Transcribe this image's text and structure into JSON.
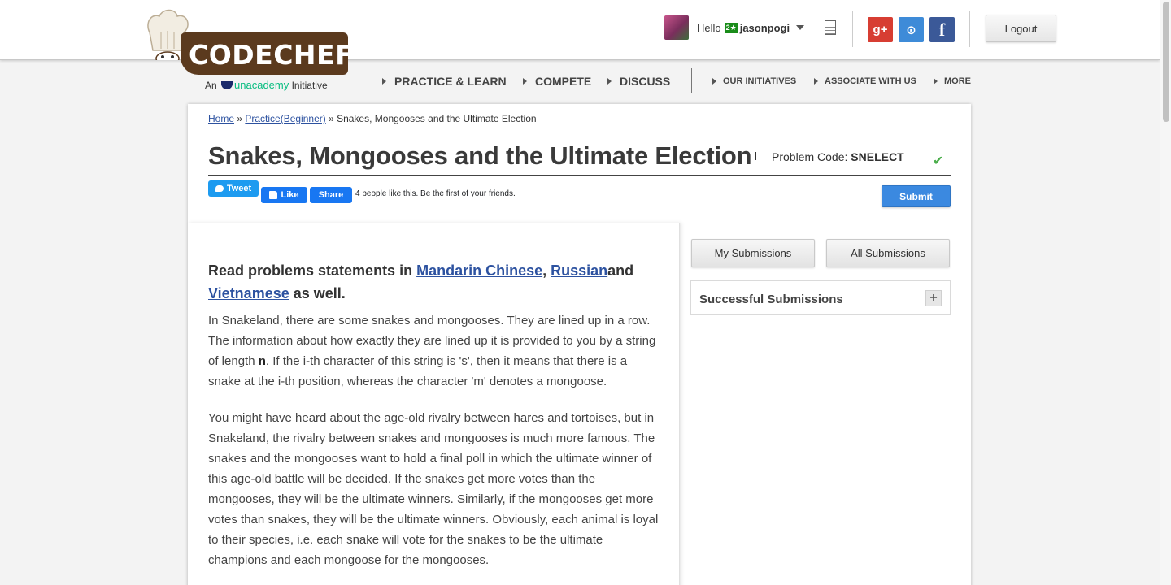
{
  "header": {
    "logo": {
      "brand": "CODECHEF",
      "sub_prefix": "An",
      "sub_brand": "unacademy",
      "sub_suffix": "Initiative"
    },
    "user": {
      "greeting": "Hello",
      "star_badge": "2★",
      "username": "jasonpogi"
    },
    "social": {
      "gplus": "g+",
      "github": "⊙",
      "facebook": "f"
    },
    "logout_label": "Logout"
  },
  "nav": {
    "main": [
      "PRACTICE & LEARN",
      "COMPETE",
      "DISCUSS"
    ],
    "secondary": [
      "OUR INITIATIVES",
      "ASSOCIATE WITH US",
      "MORE"
    ]
  },
  "breadcrumb": {
    "home": "Home",
    "sep1": " » ",
    "practice": "Practice(Beginner)",
    "sep2": " » ",
    "current": "Snakes, Mongooses and the Ultimate Election"
  },
  "problem": {
    "title": "Snakes, Mongooses and the Ultimate Election",
    "code_label": "Problem Code: ",
    "code": "SNELECT"
  },
  "share": {
    "tweet": "Tweet",
    "like": "Like",
    "share": "Share",
    "like_count_text": "4 people like this. Be the first of your friends.",
    "submit": "Submit"
  },
  "statement": {
    "read_prefix": "Read problems statements in ",
    "lang1": "Mandarin Chinese",
    "comma": ", ",
    "lang2": "Russian",
    "and": "and",
    "lang3": "Vietnamese",
    "read_suffix": " as well.",
    "p1_a": "In Snakeland, there are some snakes and mongooses. They are lined up in a row. The information about how exactly they are lined up it is provided to you by a string of length ",
    "p1_n": "n",
    "p1_b": ". If the i-th character of this string is 's', then it means that there is a snake at the i-th position, whereas the character 'm' denotes a mongoose.",
    "p2": "You might have heard about the age-old rivalry between hares and tortoises, but in Snakeland, the rivalry between snakes and mongooses is much more famous. The snakes and the mongooses want to hold a final poll in which the ultimate winner of this age-old battle will be decided. If the snakes get more votes than the mongooses, they will be the ultimate winners. Similarly, if the mongooses get more votes than snakes, they will be the ultimate winners. Obviously, each animal is loyal to their species, i.e. each snake will vote for the snakes to be the ultimate champions and each mongoose for the mongooses."
  },
  "sidebar": {
    "my_submissions": "My Submissions",
    "all_submissions": "All Submissions",
    "successful_submissions": "Successful Submissions",
    "expand": "+"
  }
}
